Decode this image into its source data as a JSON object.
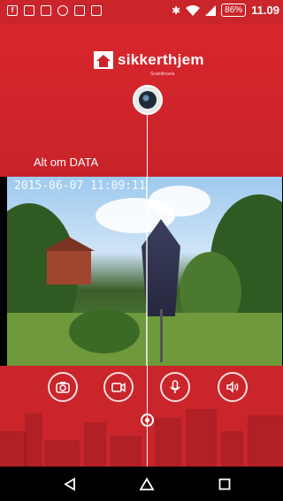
{
  "status": {
    "left_icons": [
      "facebook-icon",
      "gallery-icon",
      "screen-share-icon",
      "qr-icon",
      "document-icon",
      "app-update-icon"
    ],
    "battery": "86%",
    "time": "11.09",
    "right_icons": [
      "bluetooth-icon",
      "wifi-icon",
      "signal-icon"
    ]
  },
  "brand": {
    "logo_text": "sikkerthjem",
    "logo_sub": "Scandinavia"
  },
  "header": {
    "site_label": "Alt om DATA"
  },
  "video": {
    "timestamp": "2015-06-07 11:09:11"
  },
  "controls": [
    "camera-icon",
    "video-record-icon",
    "microphone-icon",
    "speaker-icon"
  ],
  "colors": {
    "primary": "#c9252b",
    "accent": "#ffffff"
  },
  "nav": [
    "back-icon",
    "home-icon",
    "recents-icon"
  ]
}
